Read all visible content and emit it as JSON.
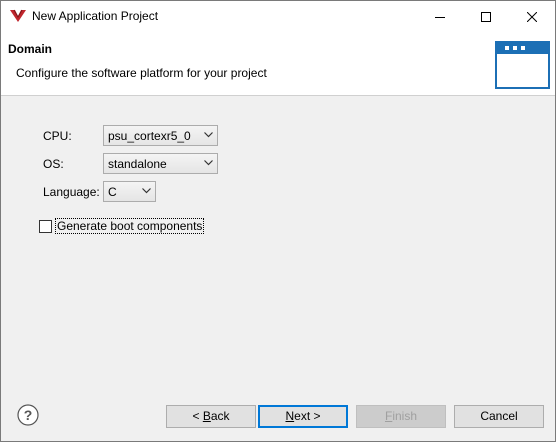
{
  "window": {
    "title": "New Application Project"
  },
  "banner": {
    "title": "Domain",
    "description": "Configure the software platform for your project",
    "icon": "window-wizard-icon"
  },
  "form": {
    "cpu": {
      "label": "CPU:",
      "value": "psu_cortexr5_0"
    },
    "os": {
      "label": "OS:",
      "value": "standalone"
    },
    "language": {
      "label": "Language:",
      "value": "C"
    },
    "boot": {
      "label": "Generate boot components",
      "checked": false
    }
  },
  "buttons": {
    "back": {
      "prefix": "< ",
      "mnemonic": "B",
      "rest": "ack"
    },
    "next": {
      "mnemonic": "N",
      "rest": "ext >"
    },
    "finish": {
      "mnemonic": "F",
      "rest": "inish"
    },
    "cancel": {
      "label": "Cancel"
    }
  },
  "colors": {
    "accent": "#0078d7",
    "banner_icon": "#1c6fb5",
    "app_icon": "#c0262d"
  }
}
